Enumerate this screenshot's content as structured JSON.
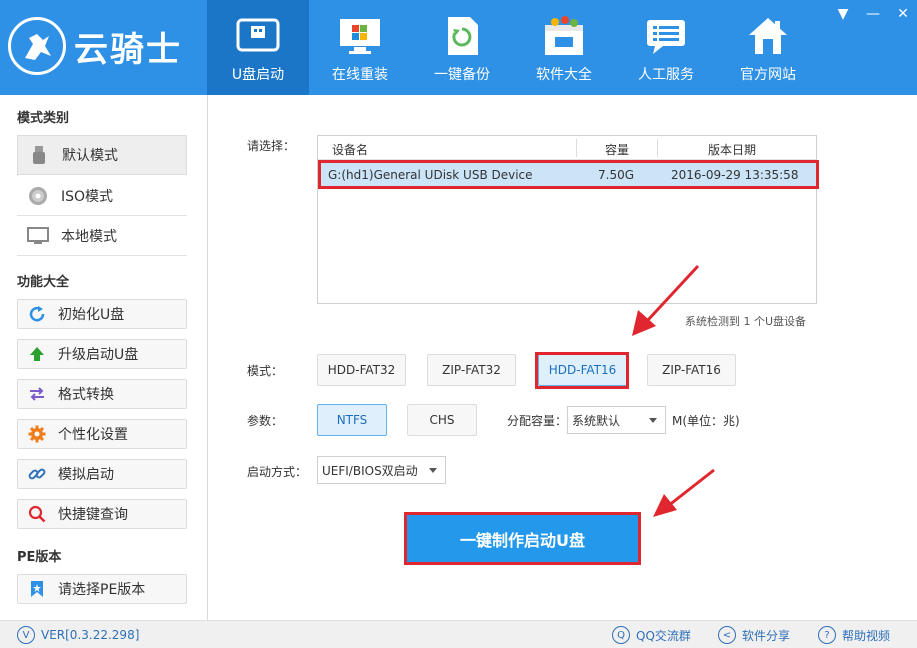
{
  "window": {
    "minimize_glyph": "▼",
    "close_glyph": "✕"
  },
  "logo": {
    "text": "云骑士"
  },
  "nav": [
    {
      "label": "U盘启动",
      "icon": "usb-drive-icon",
      "active": true
    },
    {
      "label": "在线重装",
      "icon": "monitor-windows-icon"
    },
    {
      "label": "一键备份",
      "icon": "backup-icon"
    },
    {
      "label": "软件大全",
      "icon": "software-box-icon"
    },
    {
      "label": "人工服务",
      "icon": "chat-service-icon"
    },
    {
      "label": "官方网站",
      "icon": "home-icon"
    }
  ],
  "sidebar": {
    "mode_title": "模式类别",
    "modes": [
      {
        "label": "默认模式",
        "icon": "usb-stick-icon"
      },
      {
        "label": "ISO模式",
        "icon": "disc-icon"
      },
      {
        "label": "本地模式",
        "icon": "monitor-icon"
      }
    ],
    "func_title": "功能大全",
    "funcs": [
      {
        "label": "初始化U盘",
        "icon": "refresh-icon"
      },
      {
        "label": "升级启动U盘",
        "icon": "up-arrow-icon"
      },
      {
        "label": "格式转换",
        "icon": "swap-icon"
      },
      {
        "label": "个性化设置",
        "icon": "gear-icon"
      },
      {
        "label": "模拟启动",
        "icon": "link-icon"
      },
      {
        "label": "快捷键查询",
        "icon": "search-icon"
      }
    ],
    "pe_title": "PE版本",
    "pe_button": "请选择PE版本"
  },
  "main": {
    "select_label": "请选择：",
    "table": {
      "headers": [
        "设备名",
        "容量",
        "版本日期"
      ],
      "rows": [
        [
          "G:(hd1)General UDisk USB Device",
          "7.50G",
          "2016-09-29 13:35:58"
        ]
      ]
    },
    "detect_text": "系统检测到 1 个U盘设备",
    "mode_label": "模式：",
    "modes": [
      "HDD-FAT32",
      "ZIP-FAT32",
      "HDD-FAT16",
      "ZIP-FAT16"
    ],
    "param_label": "参数：",
    "params": [
      "NTFS",
      "CHS"
    ],
    "alloc_label": "分配容量：",
    "alloc_value": "系统默认",
    "alloc_unit": "M(单位：兆)",
    "boot_label": "启动方式：",
    "boot_value": "UEFI/BIOS双启动",
    "go_button": "一键制作启动U盘"
  },
  "footer": {
    "version": "VER[0.3.22.298]",
    "qq": "QQ交流群",
    "share": "软件分享",
    "help": "帮助视频"
  },
  "colors": {
    "header": "#2e91e6",
    "nav_active": "#1b76c8",
    "accent": "#2499ec",
    "highlight_red": "#e0262f"
  }
}
